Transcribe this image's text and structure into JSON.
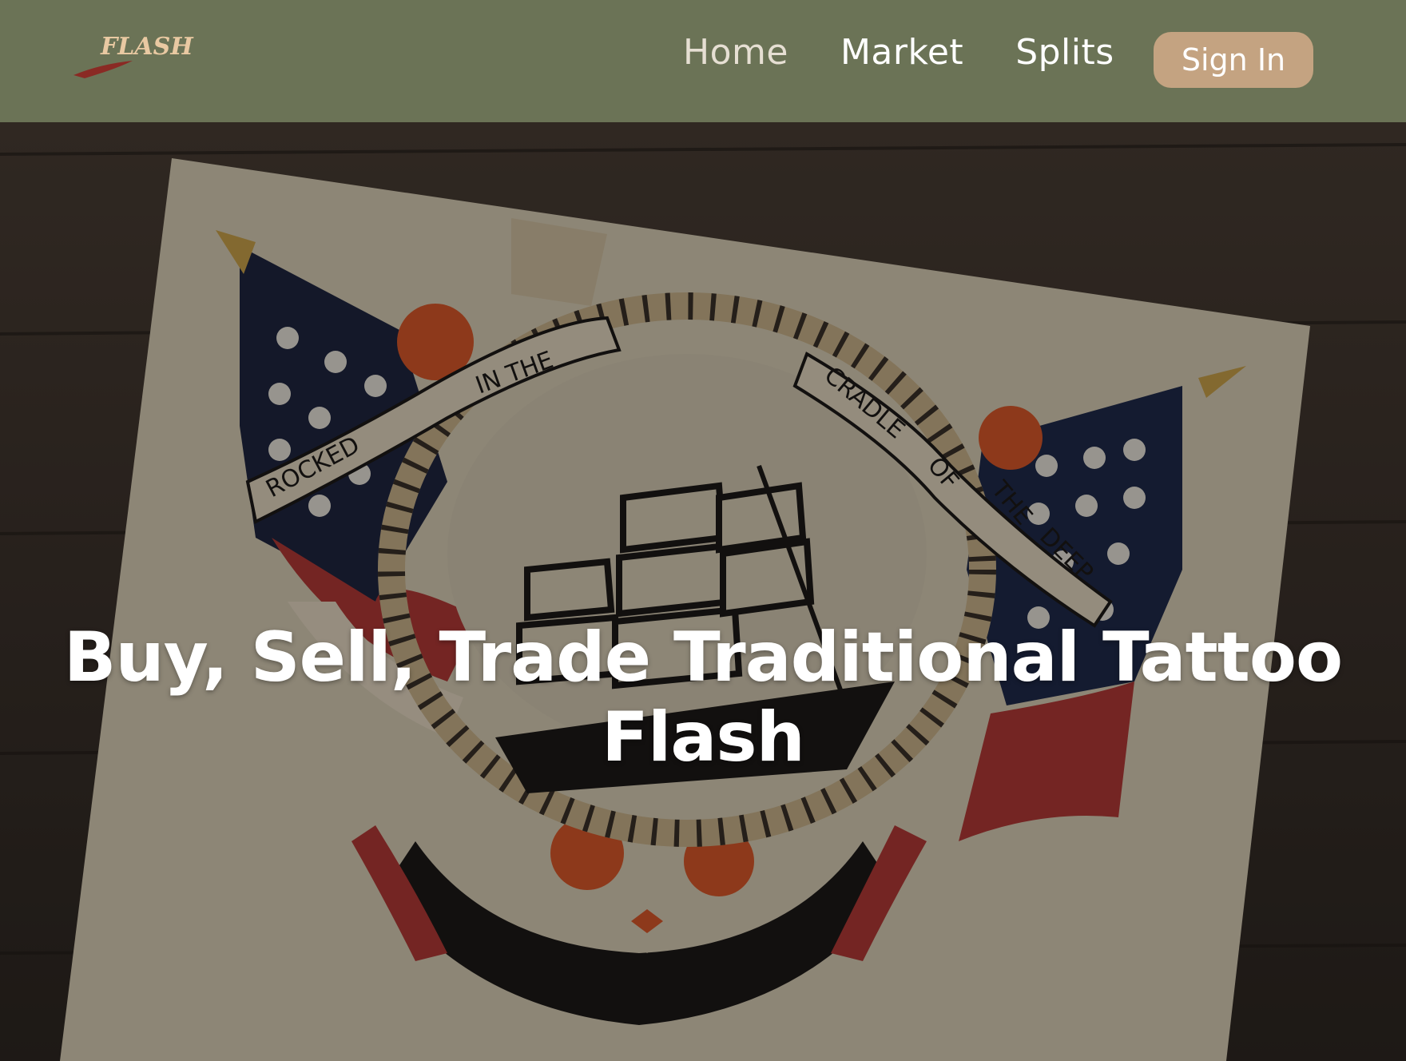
{
  "colors": {
    "navbar_bg": "#6b7356",
    "nav_home": "#e6dfd3",
    "nav_link": "#ffffff",
    "signin_bg": "#c4a381",
    "logo_text": "#e9c9a2",
    "logo_brush": "#8a2a24",
    "wood": "#3b322b",
    "paper": "#d8cdb5",
    "overlay": "rgba(0,0,0,0.35)"
  },
  "header": {
    "logo_text": "FLASH",
    "nav": [
      {
        "label": "Home"
      },
      {
        "label": "Market"
      },
      {
        "label": "Splits"
      }
    ],
    "signin_label": "Sign In"
  },
  "hero": {
    "title": "Buy, Sell, Trade Traditional Tattoo Flash",
    "banner_texts": [
      "ROCKED",
      "IN THE",
      "CRADLE",
      "OF",
      "THE",
      "DEEP"
    ]
  }
}
